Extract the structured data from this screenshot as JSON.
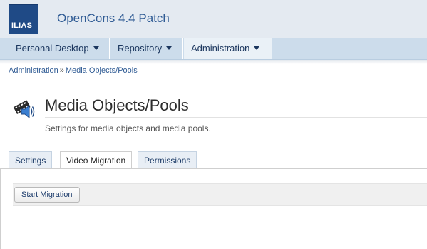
{
  "header": {
    "logo_text": "ILIAS",
    "app_title": "OpenCons 4.4 Patch"
  },
  "mainmenu": {
    "items": [
      {
        "label": "Personal Desktop"
      },
      {
        "label": "Repository"
      },
      {
        "label": "Administration"
      }
    ]
  },
  "breadcrumb": {
    "items": [
      "Administration",
      "Media Objects/Pools"
    ],
    "separator": "»"
  },
  "page": {
    "title": "Media Objects/Pools",
    "description": "Settings for media objects and media pools.",
    "icon": "media-objects-icon"
  },
  "tabs": [
    {
      "label": "Settings"
    },
    {
      "label": "Video Migration",
      "active": true
    },
    {
      "label": "Permissions"
    }
  ],
  "toolbar": {
    "start_label": "Start Migration"
  },
  "colors": {
    "logo_bg": "#1f4a86",
    "header_bg": "#e4eaf1",
    "menu_bg": "#ccdceb",
    "link": "#2f5b94"
  }
}
